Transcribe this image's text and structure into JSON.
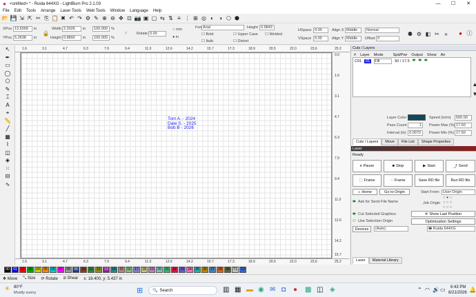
{
  "window": {
    "title": "<untitled> * - Ruida 644XG - LightBurn Pro 2.1.03",
    "min": "—",
    "max": "☐",
    "close": "✕"
  },
  "menu": [
    "File",
    "Edit",
    "Tools",
    "Arrange",
    "Laser Tools",
    "Web Tools",
    "Window",
    "Language",
    "Help"
  ],
  "numeric": {
    "xpos_label": "XPos",
    "xpos": "13.5009",
    "ypos_label": "YPos",
    "ypos": "5.2638",
    "unit_in": "in",
    "width_label": "Width",
    "width": "2.2026",
    "height_label": "Height",
    "height": "0.8892",
    "pct_w": "100.000",
    "pct_h": "100.000",
    "pct": "%",
    "rotate_label": "Rotate",
    "rotate": "0.00",
    "mm": "mm",
    "in": "in"
  },
  "text_tools": {
    "font_label": "Font",
    "font": "Arial",
    "height_label": "Height",
    "height": "0.9843",
    "hspace_label": "HSpace",
    "hspace": "0.00",
    "vspace_label": "VSpace",
    "vspace": "0.00",
    "alignx_label": "Align X",
    "alignx": "Middle",
    "aligny_label": "Align Y",
    "aligny": "Middle",
    "normal": "Normal",
    "offset_label": "Offset",
    "offset": "0",
    "bold": "Bold",
    "italic": "Italic",
    "upper": "Upper Case",
    "distort": "Distort",
    "welded": "Welded"
  },
  "ruler_top": [
    "1.6",
    "3.1",
    "4.7",
    "6.3",
    "7.9",
    "9.4",
    "11.0",
    "12.6",
    "14.2",
    "15.7",
    "17.3",
    "18.9",
    "20.5",
    "22.0",
    "23.6"
  ],
  "ruler_right_top": "25.2",
  "ruler_left": [
    "0.0",
    "1.6",
    "3.1",
    "4.7",
    "6.3",
    "7.9",
    "9.4",
    "11.0",
    "12.6",
    "14.2",
    "15.7"
  ],
  "engraving": {
    "line1": "Tom A. - 2024",
    "line2": "Dale S. -  2025",
    "line3": "Bob B  -  2026"
  },
  "cuts": {
    "title": "Cuts / Layers",
    "col_num": "#",
    "col_layer": "Layer",
    "col_mode": "Mode",
    "col_speed": "Spd/Pwr",
    "col_output": "Output",
    "col_show": "Show",
    "col_air": "Air",
    "row_id": "C01",
    "row_layer": "01",
    "row_mode": "Fill",
    "row_speed": "50 / 17.5",
    "layer_color": "Layer Color",
    "speed_label": "Speed (in/m)",
    "speed": "500.00",
    "passcount": "Pass Count",
    "passcount_val": "1",
    "powermax": "Power Max (%)",
    "powermax_val": "17.50",
    "interval": "Interval (in)",
    "interval_val": "0.0070",
    "powermin": "Power Min (%)",
    "powermin_val": "17.50",
    "tabs": [
      "Cuts / Layers",
      "Move",
      "File List",
      "Shape Properties"
    ]
  },
  "laser": {
    "title": "Laser",
    "status": "Ready",
    "pause": "Pause",
    "stop": "Stop",
    "start": "Start",
    "send": "Send",
    "frame1": "Frame",
    "frame2": "Frame",
    "save_rd": "Save RD file",
    "run_rd": "Run RD file",
    "home": "Home",
    "goto": "Go to Origin",
    "start_from": "Start From:",
    "start_from_val": "User Origin",
    "ask": "Ask for Send File Name",
    "job_origin": "Job Origin",
    "cut_sel": "Cut Selected Graphics",
    "show_last": "Show Last Position",
    "use_sel": "Use Selection Origin",
    "opt": "Optimization Settings",
    "devices": "Devices",
    "auto": "(Auto)",
    "device": "Ruida 644XG",
    "tabs": [
      "Laser",
      "Material Library"
    ]
  },
  "palette": [
    "00",
    "01",
    "02",
    "03",
    "04",
    "05",
    "06",
    "07",
    "08",
    "09",
    "10",
    "11",
    "12",
    "13",
    "14",
    "15",
    "16",
    "17",
    "18",
    "19",
    "20",
    "21",
    "22",
    "23",
    "24",
    "25",
    "26",
    "27",
    "28",
    "29",
    "T1",
    "T2"
  ],
  "palette_colors": [
    "#000000",
    "#0000ff",
    "#ff0000",
    "#00aa00",
    "#cccc00",
    "#ff8800",
    "#00cccc",
    "#ff00ff",
    "#999999",
    "#1e3c8c",
    "#8c3c1e",
    "#2a8c2a",
    "#8c8c1e",
    "#8c1e8c",
    "#1e8c8c",
    "#c08080",
    "#80c080",
    "#8080c0",
    "#c0c080",
    "#c080c0",
    "#80c0c0",
    "#3cb371",
    "#dc143c",
    "#6a5acd",
    "#ff69b4",
    "#20b2aa",
    "#b8860b",
    "#4682b4",
    "#d2691e",
    "#556b2f",
    "#c0c0c0",
    "#3366cc"
  ],
  "status": {
    "move": "Move",
    "size": "Size",
    "rotate": "Rotate",
    "shear": "Shear",
    "coords": "x: 18.400, y: 5.437 in"
  },
  "taskbar": {
    "temp": "80°F",
    "weather": "Mostly sunny",
    "search": "Search",
    "time": "6:43 PM",
    "date": "8/21/2026"
  }
}
